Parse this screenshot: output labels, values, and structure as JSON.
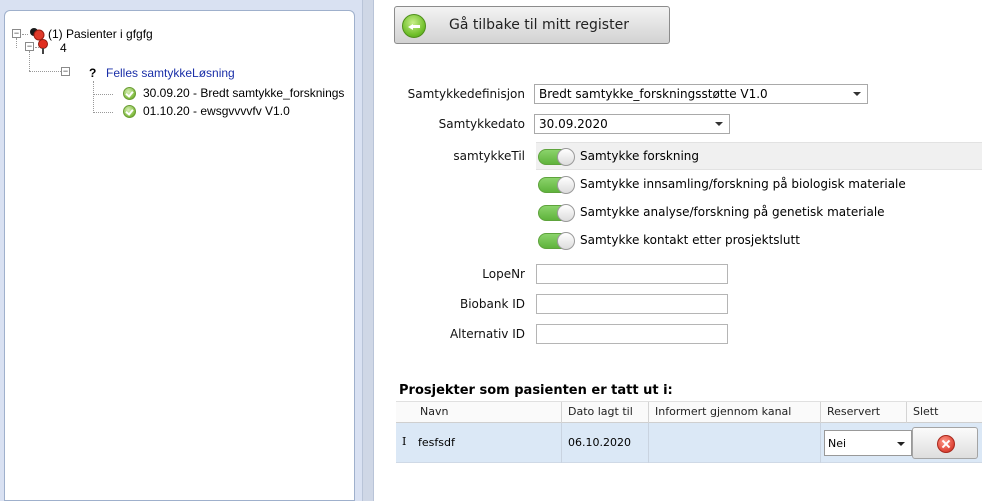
{
  "tree": {
    "root": "(1) Pasienter i gfgfg",
    "patient": "4",
    "group_mark": "?",
    "group": "Felles samtykkeLøsning",
    "items": [
      "30.09.20 - Bredt samtykke_forsknings",
      "01.10.20 - ewsgvvvvfv V1.0"
    ]
  },
  "back_button": {
    "label": "Gå tilbake til mitt register",
    "icon": "arrow-left-icon"
  },
  "form": {
    "samtykkedefinisjon_label": "Samtykkedefinisjon",
    "samtykkedefinisjon_value": "Bredt samtykke_forskningsstøtte V1.0",
    "samtykkedato_label": "Samtykkedato",
    "samtykkedato_value": "30.09.2020",
    "samtykketil_label": "samtykkeTil",
    "toggles": [
      {
        "label": "Samtykke forskning",
        "on": true
      },
      {
        "label": "Samtykke innsamling/forskning på biologisk materiale",
        "on": true
      },
      {
        "label": "Samtykke analyse/forskning på genetisk materiale",
        "on": true
      },
      {
        "label": "Samtykke kontakt etter prosjektslutt",
        "on": true
      }
    ],
    "lopenr_label": "LopeNr",
    "lopenr_value": "",
    "biobank_label": "Biobank ID",
    "biobank_value": "",
    "alternativ_label": "Alternativ ID",
    "alternativ_value": ""
  },
  "projects": {
    "title": "Prosjekter som pasienten er tatt ut i:",
    "columns": [
      "Navn",
      "Dato lagt til",
      "Informert gjennom kanal",
      "Reservert",
      "Slett"
    ],
    "rows": [
      {
        "indicator": "I",
        "navn": "fesfsdf",
        "dato": "06.10.2020",
        "kanal": "",
        "reservert": "Nei"
      }
    ]
  },
  "colors": {
    "accent_green": "#6fbf2a",
    "row_selected": "#dbe8f6",
    "delete_red": "#e0483a"
  }
}
